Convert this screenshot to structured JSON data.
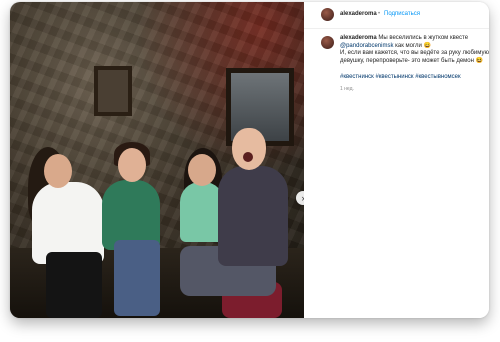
{
  "post": {
    "username": "alexaderoma",
    "separator": "•",
    "follow_label": "Подписаться",
    "caption_line1": "Мы веселились в жутком квесте",
    "mention": "@pandorabcenimsk",
    "caption_line2_rest": " как могли 😄",
    "caption_line3": "И, если вам кажется, что вы ведёте за руку любимую",
    "caption_line4": "девушку, перепроверьте- это может быть демон 😆",
    "hashtags": [
      "#квестнинск",
      "#квестынинск",
      "#квестывномсек"
    ],
    "time": "1 нед."
  },
  "carousel": {
    "next_icon": "›"
  },
  "colors": {
    "link": "#0095f6",
    "hashtag": "#00376b",
    "text": "#262626",
    "muted": "#8e8e8e"
  }
}
